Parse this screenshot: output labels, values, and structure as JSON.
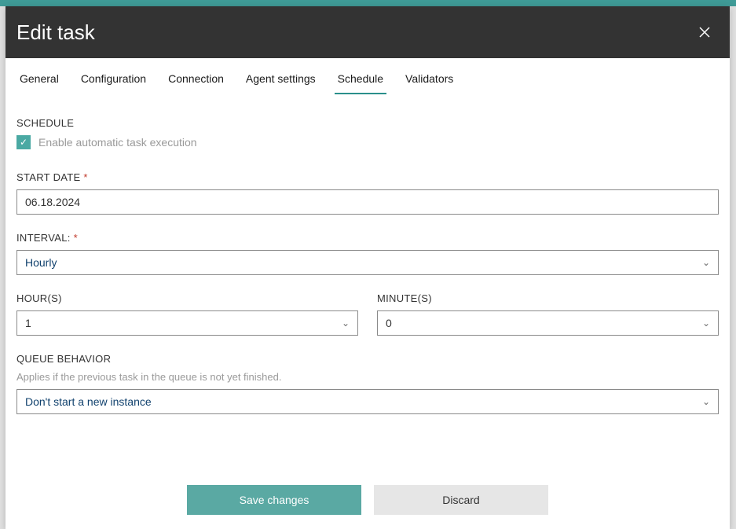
{
  "header": {
    "title": "Edit task"
  },
  "tabs": {
    "general": "General",
    "configuration": "Configuration",
    "connection": "Connection",
    "agent_settings": "Agent settings",
    "schedule": "Schedule",
    "validators": "Validators"
  },
  "schedule": {
    "section_label": "SCHEDULE",
    "enable_label": "Enable automatic task execution",
    "enable_checked": true,
    "start_date_label": "START DATE",
    "start_date_value": "06.18.2024",
    "interval_label": "INTERVAL:",
    "interval_value": "Hourly",
    "hours_label": "HOUR(S)",
    "hours_value": "1",
    "minutes_label": "MINUTE(S)",
    "minutes_value": "0",
    "queue_label": "QUEUE BEHAVIOR",
    "queue_hint": "Applies if the previous task in the queue is not yet finished.",
    "queue_value": "Don't start a new instance",
    "required_mark": "*"
  },
  "actions": {
    "save": "Save changes",
    "discard": "Discard"
  }
}
